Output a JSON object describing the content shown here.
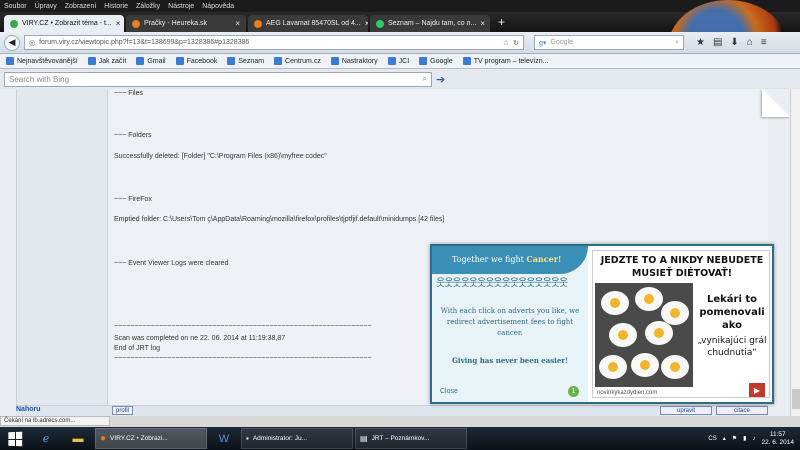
{
  "menu": [
    "Soubor",
    "Úpravy",
    "Zobrazení",
    "Historie",
    "Záložky",
    "Nástroje",
    "Nápověda"
  ],
  "tabs": [
    {
      "label": "VIRY.CZ • Zobrazit téma - t...",
      "active": true,
      "color": "#3aa84a"
    },
    {
      "label": "Pračky - Heureka.sk",
      "active": false,
      "color": "#e67e22"
    },
    {
      "label": "AEG Lavamat 85470SL od 4...",
      "active": false,
      "color": "#e67e22"
    },
    {
      "label": "Seznam – Najdu tam, co n...",
      "active": false,
      "color": "#2ecc71"
    }
  ],
  "nav": {
    "url": "forum.viry.cz/viewtopic.php?f=13&t=138699&p=1328386#p1328386",
    "search_placeholder": "Google"
  },
  "bookmarks": [
    "Nejnavštěvovanější",
    "Jak začít",
    "Gmail",
    "Facebook",
    "Seznam",
    "Centrum.cz",
    "Nastraktory",
    "JCI",
    "Google",
    "TV program – televízn..."
  ],
  "bing": {
    "placeholder": "Search with Bing"
  },
  "post": {
    "lines": [
      "~~~ Files",
      "~~~ Folders",
      "Successfully deleted: [Folder] \"C:\\Program Files (x86)\\myfree codec\"",
      "~~~ FireFox",
      "Emptied folder: C:\\Users\\Tom ç\\AppData\\Roaming\\mozilla\\firefox\\profiles\\tjptfjif.default\\minidumps [42 files]",
      "~~~ Event Viewer Logs were cleared",
      "~~~~~~~~~~~~~~~~~~~~~~~~~~~~~~~~~~~~~~~~~~~~~~~~~~~~~~~~~~~~~~~",
      "Scan was completed on ne 22. 06. 2014 at 11:19:38,87",
      "End of JRT log",
      "~~~~~~~~~~~~~~~~~~~~~~~~~~~~~~~~~~~~~~~~~~~~~~~~~~~~~~~~~~~~~~~"
    ],
    "nahoru": "Nahoru",
    "profil": "profil",
    "upravit": "upravit",
    "citace": "citace"
  },
  "ad": {
    "head_prefix": "Together we fight ",
    "head_emph": "Cancer!",
    "text": "With each click on adverts you like, we redirect advertisement fees to fight cancer.",
    "strong": "Giving has never been easier!",
    "close": "Close",
    "num": "1",
    "title": "JEDZTE TO A NIKDY NEBUDETE MUSIEŤ DIÉTOVAŤ!",
    "sub": "Lekári to pomenovali ako",
    "sub2": "„vynikajúci grál chudnutia\"",
    "site": "novinkykazdydien.com"
  },
  "status": "Čekání na lb.adrecs.com...",
  "taskbar": {
    "items": [
      {
        "label": "VIRY.CZ • Zobrazi...",
        "icon": "firefox-icon"
      },
      {
        "label": "Administrator: Ju...",
        "icon": "cmd-icon"
      },
      {
        "label": "JRT – Poznámkov...",
        "icon": "notepad-icon"
      }
    ],
    "lang": "CS",
    "time": "11:57",
    "date": "22. 6. 2014"
  }
}
